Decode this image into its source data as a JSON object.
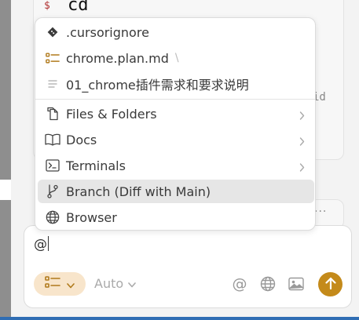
{
  "terminal": {
    "prompt_symbol": "$",
    "command": "cd",
    "trailing_text": "id"
  },
  "background_card": {
    "more_label": "···"
  },
  "mention_menu": {
    "recent": [
      {
        "label": ".cursorignore",
        "icon": "git-diamond-icon"
      },
      {
        "label": "chrome.plan.md",
        "suffix": "\\",
        "icon": "checklist-icon"
      },
      {
        "label": "01_chrome插件需求和要求说明",
        "icon": "text-lines-icon"
      }
    ],
    "categories": [
      {
        "label": "Files & Folders",
        "icon": "files-icon",
        "has_submenu": true
      },
      {
        "label": "Docs",
        "icon": "book-icon",
        "has_submenu": true
      },
      {
        "label": "Terminals",
        "icon": "terminal-icon",
        "has_submenu": true
      },
      {
        "label": "Branch (Diff with Main)",
        "icon": "git-branch-icon",
        "has_submenu": false,
        "selected": true
      },
      {
        "label": "Browser",
        "icon": "globe-icon",
        "has_submenu": false
      }
    ]
  },
  "composer": {
    "input_value": "@",
    "mode_icon": "checklist-icon",
    "model_label": "Auto",
    "tools": [
      "at-mention-icon",
      "globe-icon",
      "image-icon"
    ],
    "send_icon": "arrow-up-icon"
  },
  "colors": {
    "accent": "#c48a1a",
    "mode_pill_bg": "#f8e5cb",
    "status_bar": "#2f6db3",
    "selected_row": "#e6e6e6"
  }
}
